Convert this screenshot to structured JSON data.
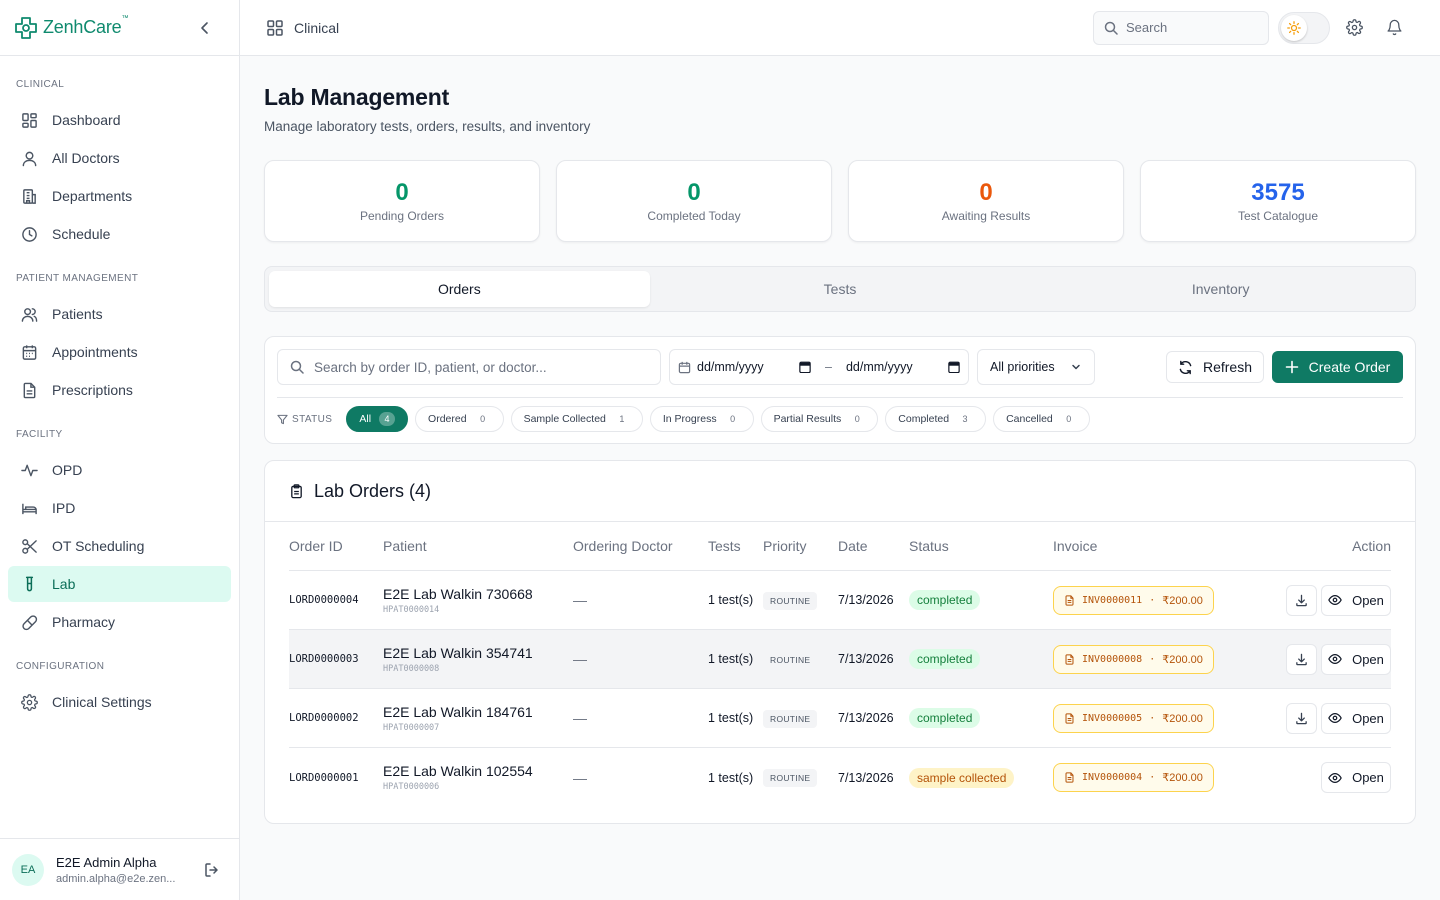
{
  "brand": {
    "name": "ZenhCare",
    "tm": "™"
  },
  "sidebar": {
    "sections": [
      {
        "label": "CLINICAL",
        "items": [
          {
            "label": "Dashboard",
            "icon": "dashboard-icon"
          },
          {
            "label": "All Doctors",
            "icon": "user-icon"
          },
          {
            "label": "Departments",
            "icon": "building-icon"
          },
          {
            "label": "Schedule",
            "icon": "clock-icon"
          }
        ]
      },
      {
        "label": "PATIENT MANAGEMENT",
        "items": [
          {
            "label": "Patients",
            "icon": "users-icon"
          },
          {
            "label": "Appointments",
            "icon": "calendar-icon"
          },
          {
            "label": "Prescriptions",
            "icon": "file-icon"
          }
        ]
      },
      {
        "label": "FACILITY",
        "items": [
          {
            "label": "OPD",
            "icon": "activity-icon"
          },
          {
            "label": "IPD",
            "icon": "bed-icon"
          },
          {
            "label": "OT Scheduling",
            "icon": "scissors-icon"
          },
          {
            "label": "Lab",
            "icon": "test-tube-icon",
            "active": true
          },
          {
            "label": "Pharmacy",
            "icon": "pill-icon"
          }
        ]
      },
      {
        "label": "CONFIGURATION",
        "items": [
          {
            "label": "Clinical Settings",
            "icon": "gear-icon"
          }
        ]
      }
    ],
    "user": {
      "initials": "EA",
      "name": "E2E Admin Alpha",
      "email": "admin.alpha@e2e.zen..."
    }
  },
  "topbar": {
    "breadcrumb": "Clinical",
    "search_placeholder": "Search"
  },
  "page": {
    "title": "Lab Management",
    "subtitle": "Manage laboratory tests, orders, results, and inventory"
  },
  "stats": [
    {
      "value": "0",
      "label": "Pending Orders",
      "color": "#059669"
    },
    {
      "value": "0",
      "label": "Completed Today",
      "color": "#059669"
    },
    {
      "value": "0",
      "label": "Awaiting Results",
      "color": "#ea580c"
    },
    {
      "value": "3575",
      "label": "Test Catalogue",
      "color": "#2563eb"
    }
  ],
  "tabs": [
    {
      "label": "Orders",
      "active": true
    },
    {
      "label": "Tests"
    },
    {
      "label": "Inventory"
    }
  ],
  "filters": {
    "search_placeholder": "Search by order ID, patient, or doctor...",
    "date_from": "dd/mm/yyyy",
    "date_sep": "–",
    "date_to": "dd/mm/yyyy",
    "priority": "All priorities",
    "refresh_label": "Refresh",
    "create_label": "Create Order",
    "status_label": "STATUS",
    "chips": [
      {
        "label": "All",
        "count": "4",
        "active": true
      },
      {
        "label": "Ordered",
        "count": "0"
      },
      {
        "label": "Sample Collected",
        "count": "1"
      },
      {
        "label": "In Progress",
        "count": "0"
      },
      {
        "label": "Partial Results",
        "count": "0"
      },
      {
        "label": "Completed",
        "count": "3"
      },
      {
        "label": "Cancelled",
        "count": "0"
      }
    ]
  },
  "orders": {
    "title": "Lab Orders (4)",
    "columns": [
      "Order ID",
      "Patient",
      "Ordering Doctor",
      "Tests",
      "Priority",
      "Date",
      "Status",
      "Invoice",
      "Action"
    ],
    "rows": [
      {
        "id": "LORD0000004",
        "patient": "E2E Lab Walkin 730668",
        "patient_id": "HPAT0000014",
        "doctor": "—",
        "tests": "1 test(s)",
        "priority": "ROUTINE",
        "date": "7/13/2026",
        "status": "completed",
        "invoice": "INV0000011",
        "amount": "₹200.00",
        "download": true,
        "open": "Open"
      },
      {
        "id": "LORD0000003",
        "patient": "E2E Lab Walkin 354741",
        "patient_id": "HPAT0000008",
        "doctor": "—",
        "tests": "1 test(s)",
        "priority": "ROUTINE",
        "date": "7/13/2026",
        "status": "completed",
        "invoice": "INV0000008",
        "amount": "₹200.00",
        "download": true,
        "open": "Open",
        "highlight": true
      },
      {
        "id": "LORD0000002",
        "patient": "E2E Lab Walkin 184761",
        "patient_id": "HPAT0000007",
        "doctor": "—",
        "tests": "1 test(s)",
        "priority": "ROUTINE",
        "date": "7/13/2026",
        "status": "completed",
        "invoice": "INV0000005",
        "amount": "₹200.00",
        "download": true,
        "open": "Open"
      },
      {
        "id": "LORD0000001",
        "patient": "E2E Lab Walkin 102554",
        "patient_id": "HPAT0000006",
        "doctor": "—",
        "tests": "1 test(s)",
        "priority": "ROUTINE",
        "date": "7/13/2026",
        "status": "sample collected",
        "invoice": "INV0000004",
        "amount": "₹200.00",
        "download": false,
        "open": "Open"
      }
    ]
  }
}
